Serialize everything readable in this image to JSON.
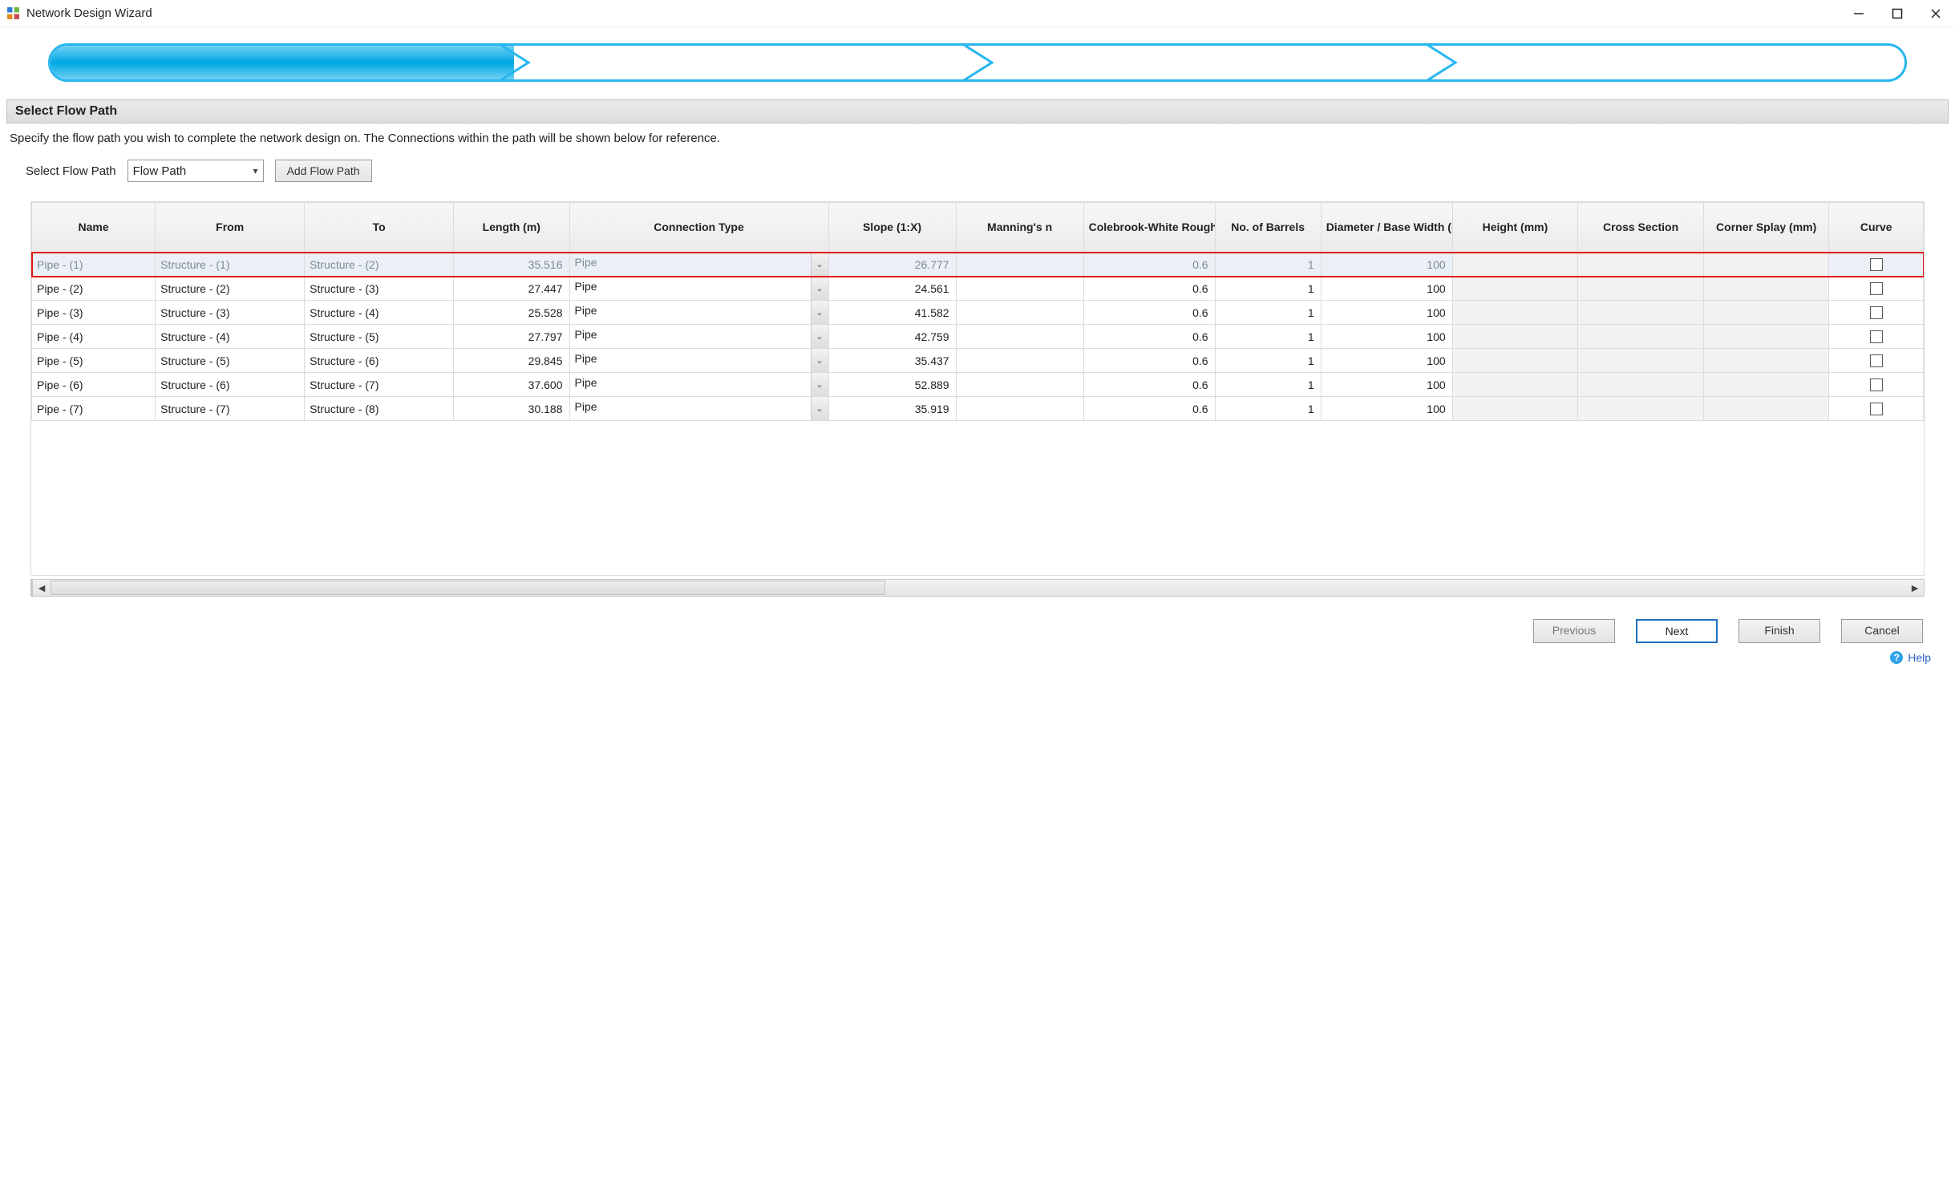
{
  "window": {
    "title": "Network Design Wizard"
  },
  "section": {
    "header": "Select Flow Path",
    "description": "Specify the flow path you wish to complete the network design on. The Connections within the path will be shown below for reference."
  },
  "controls": {
    "select_label": "Select Flow Path",
    "select_value": "Flow Path",
    "add_button": "Add Flow Path"
  },
  "table": {
    "headers": {
      "name": "Name",
      "from": "From",
      "to": "To",
      "length": "Length (m)",
      "conn": "Connection Type",
      "slope": "Slope (1:X)",
      "mannings": "Manning's n",
      "colebrook": "Colebrook-White Roughnes",
      "barrels": "No. of Barrels",
      "diameter": "Diameter / Base Width (m",
      "height": "Height (mm)",
      "cross": "Cross Section",
      "corner": "Corner Splay (mm)",
      "curve": "Curve"
    },
    "rows": [
      {
        "name": "Pipe - (1)",
        "from": "Structure - (1)",
        "to": "Structure - (2)",
        "length": "35.516",
        "conn": "Pipe",
        "slope": "26.777",
        "mannings": "",
        "colebrook": "0.6",
        "barrels": "1",
        "diameter": "100",
        "height": "",
        "cross": "",
        "corner": "",
        "curve": false,
        "selected": true
      },
      {
        "name": "Pipe - (2)",
        "from": "Structure - (2)",
        "to": "Structure - (3)",
        "length": "27.447",
        "conn": "Pipe",
        "slope": "24.561",
        "mannings": "",
        "colebrook": "0.6",
        "barrels": "1",
        "diameter": "100",
        "height": "",
        "cross": "",
        "corner": "",
        "curve": false,
        "selected": false
      },
      {
        "name": "Pipe - (3)",
        "from": "Structure - (3)",
        "to": "Structure - (4)",
        "length": "25.528",
        "conn": "Pipe",
        "slope": "41.582",
        "mannings": "",
        "colebrook": "0.6",
        "barrels": "1",
        "diameter": "100",
        "height": "",
        "cross": "",
        "corner": "",
        "curve": false,
        "selected": false
      },
      {
        "name": "Pipe - (4)",
        "from": "Structure - (4)",
        "to": "Structure - (5)",
        "length": "27.797",
        "conn": "Pipe",
        "slope": "42.759",
        "mannings": "",
        "colebrook": "0.6",
        "barrels": "1",
        "diameter": "100",
        "height": "",
        "cross": "",
        "corner": "",
        "curve": false,
        "selected": false
      },
      {
        "name": "Pipe - (5)",
        "from": "Structure - (5)",
        "to": "Structure - (6)",
        "length": "29.845",
        "conn": "Pipe",
        "slope": "35.437",
        "mannings": "",
        "colebrook": "0.6",
        "barrels": "1",
        "diameter": "100",
        "height": "",
        "cross": "",
        "corner": "",
        "curve": false,
        "selected": false
      },
      {
        "name": "Pipe - (6)",
        "from": "Structure - (6)",
        "to": "Structure - (7)",
        "length": "37.600",
        "conn": "Pipe",
        "slope": "52.889",
        "mannings": "",
        "colebrook": "0.6",
        "barrels": "1",
        "diameter": "100",
        "height": "",
        "cross": "",
        "corner": "",
        "curve": false,
        "selected": false
      },
      {
        "name": "Pipe - (7)",
        "from": "Structure - (7)",
        "to": "Structure - (8)",
        "length": "30.188",
        "conn": "Pipe",
        "slope": "35.919",
        "mannings": "",
        "colebrook": "0.6",
        "barrels": "1",
        "diameter": "100",
        "height": "",
        "cross": "",
        "corner": "",
        "curve": false,
        "selected": false
      }
    ]
  },
  "footer": {
    "previous": "Previous",
    "next": "Next",
    "finish": "Finish",
    "cancel": "Cancel",
    "help": "Help"
  }
}
